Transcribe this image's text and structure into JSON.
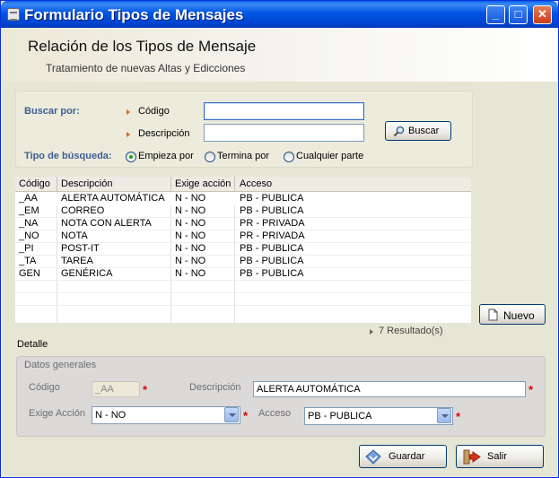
{
  "window": {
    "title": "Formulario Tipos de Mensajes",
    "controls": {
      "minimize": "_",
      "maximize": "□",
      "close": "✕"
    }
  },
  "header": {
    "title": "Relación de los Tipos de Mensaje",
    "subtitle": "Tratamiento de nuevas Altas y Edicciones"
  },
  "search": {
    "buscar_por_label": "Buscar por:",
    "codigo_label": "Código",
    "codigo_value": "",
    "descripcion_label": "Descripción",
    "descripcion_value": "",
    "buscar_button": "Buscar",
    "tipo_label": "Tipo de búsqueda:",
    "options": [
      {
        "label": "Empieza por",
        "selected": true
      },
      {
        "label": "Termina por",
        "selected": false
      },
      {
        "label": "Cualquier parte",
        "selected": false
      }
    ]
  },
  "grid": {
    "columns": [
      "Código",
      "Descripción",
      "Exige acción",
      "Acceso"
    ],
    "rows": [
      {
        "codigo": "_AA",
        "descripcion": "ALERTA AUTOMÁTICA",
        "exige": "N - NO",
        "acceso": "PB - PUBLICA"
      },
      {
        "codigo": "_EM",
        "descripcion": "CORREO",
        "exige": "N - NO",
        "acceso": "PB - PUBLICA"
      },
      {
        "codigo": "_NA",
        "descripcion": "NOTA CON ALERTA",
        "exige": "N - NO",
        "acceso": "PR - PRIVADA"
      },
      {
        "codigo": "_NO",
        "descripcion": "NOTA",
        "exige": "N - NO",
        "acceso": "PR - PRIVADA"
      },
      {
        "codigo": "_PI",
        "descripcion": "POST-IT",
        "exige": "N - NO",
        "acceso": "PB - PUBLICA"
      },
      {
        "codigo": "_TA",
        "descripcion": "TAREA",
        "exige": "N - NO",
        "acceso": "PB - PUBLICA"
      },
      {
        "codigo": "GEN",
        "descripcion": "GENÉRICA",
        "exige": "N - NO",
        "acceso": "PB - PUBLICA"
      }
    ]
  },
  "nuevo_button": "Nuevo",
  "results_text": "7 Resultado(s)",
  "detalle": {
    "section_label": "Detalle",
    "group_label": "Datos generales",
    "codigo_label": "Código",
    "codigo_value": "_AA",
    "descripcion_label": "Descripción",
    "descripcion_value": "ALERTA AUTOMÁTICA",
    "exige_label": "Exige Acción",
    "exige_value": "N - NO",
    "acceso_label": "Acceso",
    "acceso_value": "PB - PUBLICA",
    "required_mark": "*"
  },
  "footer": {
    "guardar_button": "Guardar",
    "salir_button": "Salir"
  },
  "colors": {
    "titlebar": "#0054e3",
    "accent_label": "#3f5e92",
    "required": "#e00000"
  }
}
